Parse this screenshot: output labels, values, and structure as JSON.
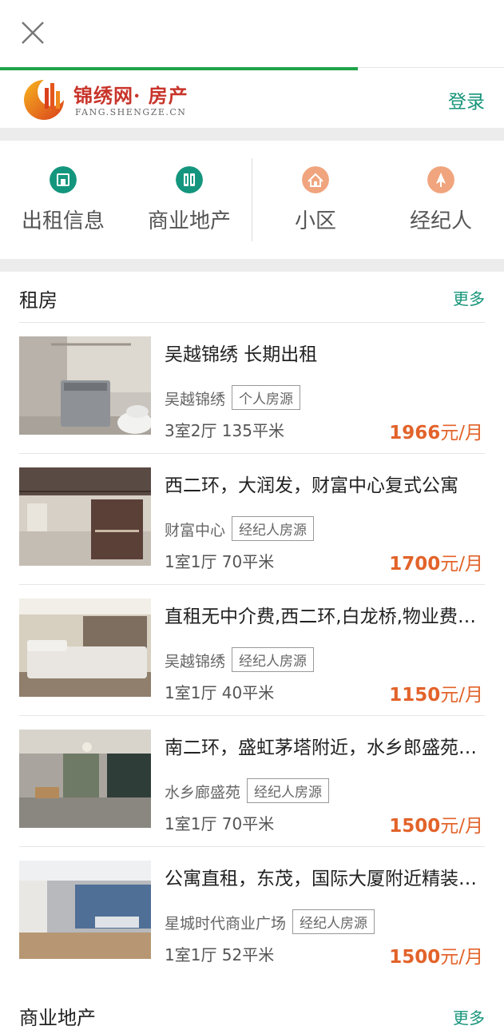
{
  "brand": {
    "name": "锦绣网",
    "suffix": "· 房产",
    "domain": "FANG.SHENGZE.CN",
    "login": "登录"
  },
  "progress_percent": 71,
  "nav": [
    {
      "label": "出租信息",
      "icon": "building-icon",
      "color": "#14967e"
    },
    {
      "label": "商业地产",
      "icon": "shop-icon",
      "color": "#14967e"
    },
    {
      "label": "小区",
      "icon": "community-icon",
      "color": "#f0a57e"
    },
    {
      "label": "经纪人",
      "icon": "agent-icon",
      "color": "#f0a57e"
    }
  ],
  "rent_section": {
    "title": "租房",
    "more": "更多",
    "listings": [
      {
        "title": "吴越锦绣 长期出租",
        "location": "吴越锦绣",
        "tag": "个人房源",
        "spec": "3室2厅 135平米",
        "price_num": "1966",
        "price_unit": "元/月"
      },
      {
        "title": "西二环，大润发，财富中心复式公寓",
        "location": "财富中心",
        "tag": "经纪人房源",
        "spec": "1室1厅 70平米",
        "price_num": "1700",
        "price_unit": "元/月"
      },
      {
        "title": "直租无中介费,西二环,白龙桥,物业费全包",
        "location": "吴越锦绣",
        "tag": "经纪人房源",
        "spec": "1室1厅 40平米",
        "price_num": "1150",
        "price_unit": "元/月"
      },
      {
        "title": "南二环，盛虹茅塔附近，水乡郎盛苑公寓",
        "location": "水乡廊盛苑",
        "tag": "经纪人房源",
        "spec": "1室1厅 70平米",
        "price_num": "1500",
        "price_unit": "元/月"
      },
      {
        "title": "公寓直租，东茂，国际大厦附近精装公寓",
        "location": "星城时代商业广场",
        "tag": "经纪人房源",
        "spec": "1室1厅 52平米",
        "price_num": "1500",
        "price_unit": "元/月"
      }
    ]
  },
  "commercial_section": {
    "title": "商业地产",
    "more": "更多"
  },
  "colors": {
    "accent_green": "#16947a",
    "price_orange": "#e2632a",
    "progress_green": "#1fa349",
    "brand_red": "#c8342a"
  }
}
